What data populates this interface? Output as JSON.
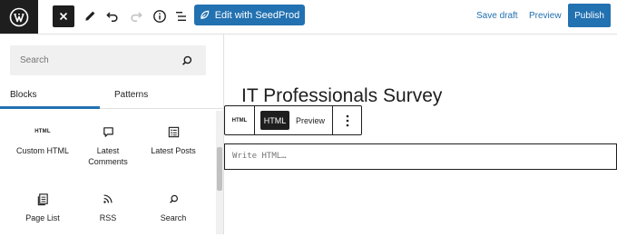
{
  "toolbar": {
    "seedprod_label": "Edit with SeedProd",
    "save_draft_label": "Save draft",
    "preview_label": "Preview",
    "publish_label": "Publish",
    "accent_color": "#2271b1"
  },
  "sidebar": {
    "search_placeholder": "Search",
    "tabs": {
      "blocks": "Blocks",
      "patterns": "Patterns"
    },
    "blocks": [
      {
        "icon": "html-icon",
        "icon_text": "HTML",
        "label": "Custom HTML"
      },
      {
        "icon": "speech-bubble-icon",
        "label": "Latest\nComments"
      },
      {
        "icon": "posts-list-icon",
        "label": "Latest Posts"
      },
      {
        "icon": "page-list-icon",
        "label": "Page List"
      },
      {
        "icon": "rss-icon",
        "label": "RSS"
      },
      {
        "icon": "search-icon",
        "label": "Search"
      }
    ]
  },
  "editor": {
    "post_title": "IT Professionals Survey",
    "block_toolbar": {
      "html_icon_text": "HTML",
      "html_label": "HTML",
      "preview_label": "Preview"
    },
    "html_placeholder": "Write HTML…"
  }
}
